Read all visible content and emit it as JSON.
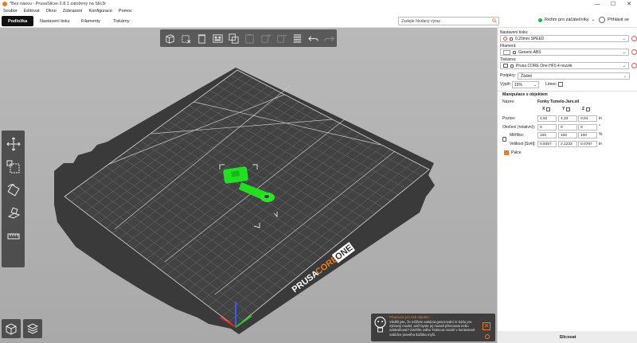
{
  "window": {
    "title": "*Bez názvu - PrusaSlicer-2.8.1 založený na Slic3r",
    "controls": [
      "—",
      "☐",
      "✕"
    ]
  },
  "menu": [
    "Soubor",
    "Editovat",
    "Okno",
    "Zobrazení",
    "Konfigurace",
    "Pomoc"
  ],
  "tabs": [
    "Podložka",
    "Nastavení tisku",
    "Filamenty",
    "Tiskárny"
  ],
  "search": {
    "placeholder": "Zadejte hledaný výraz"
  },
  "mode": {
    "label": "Režim pro začátečníky",
    "color": "#23b35a"
  },
  "login": {
    "label": "Přihlásit se"
  },
  "bed_logo": {
    "text_prusa": "PRUSA",
    "text_core": "CORE",
    "text_one": "ONE"
  },
  "notification": {
    "title": "Přepnout pro tisk objektu",
    "text": "Věděli jste, že můžete zakázat generování G-kódu pro vybraný model, aniž byste jej museli přesouvat nebo odstraňovat? Změňte volbu Tisknout model v kontextové nabídce pravého tlačítka myši.",
    "close": "✕"
  },
  "sidebar": {
    "print_settings_label": "Nastavení tisku:",
    "print_settings_value": "0.20mm SPEED",
    "filament_label": "Filament:",
    "filament_value": "Generic ABS",
    "printer_label": "Tiskárna:",
    "printer_value": "Prusa CORE One HF0.4 nozzle",
    "supports_label": "Podpěry:",
    "supports_value": "Žádné",
    "infill_label": "Výplň:",
    "infill_value": "15%",
    "brim_label": "Límec:",
    "brim_checked": false,
    "object_manipulation": "Manipulace s objektem",
    "name_label": "Název:",
    "name_value": "Funky Tumelo-Jarv.stl",
    "axes": [
      "X",
      "Y",
      "Z"
    ],
    "position_label": "Pozice:",
    "position": [
      "4,92",
      "4,33",
      "0,04"
    ],
    "position_unit": "in",
    "rotation_label": "Otočení (relativní):",
    "rotation": [
      "0",
      "0",
      "0"
    ],
    "rotation_unit": "°",
    "scale_label": "Měřítko:",
    "scale": [
      "100",
      "100",
      "100"
    ],
    "scale_unit": "%",
    "size_label": "Velikost [Svět]:",
    "size": [
      "0,9357",
      "2,1233",
      "0,0787"
    ],
    "size_unit": "in",
    "inches_label": "Palce",
    "inches_checked": true,
    "slice_button": "Slicovat"
  },
  "colors": {
    "accent": "#f07a20",
    "model": "#21e021",
    "bed": "#3a3a3a",
    "dark": "#111111"
  }
}
